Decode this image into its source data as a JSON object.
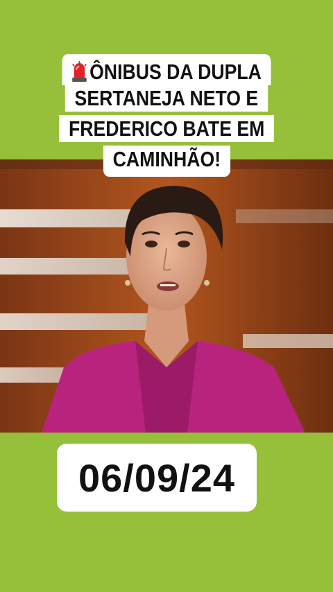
{
  "headline": {
    "icon": "police-light-icon",
    "lines": [
      "ÔNIBUS DA DUPLA",
      "SERTANEJA NETO E",
      "FREDERICO BATE EM",
      "CAMINHÃO!"
    ]
  },
  "video": {
    "description_icon": "news-anchor-video-frame"
  },
  "date": {
    "text": "06/09/24"
  },
  "colors": {
    "background": "#96bf3a",
    "caption_bg": "#ffffff",
    "text": "#111111",
    "anchor_outfit": "#b8237e"
  }
}
